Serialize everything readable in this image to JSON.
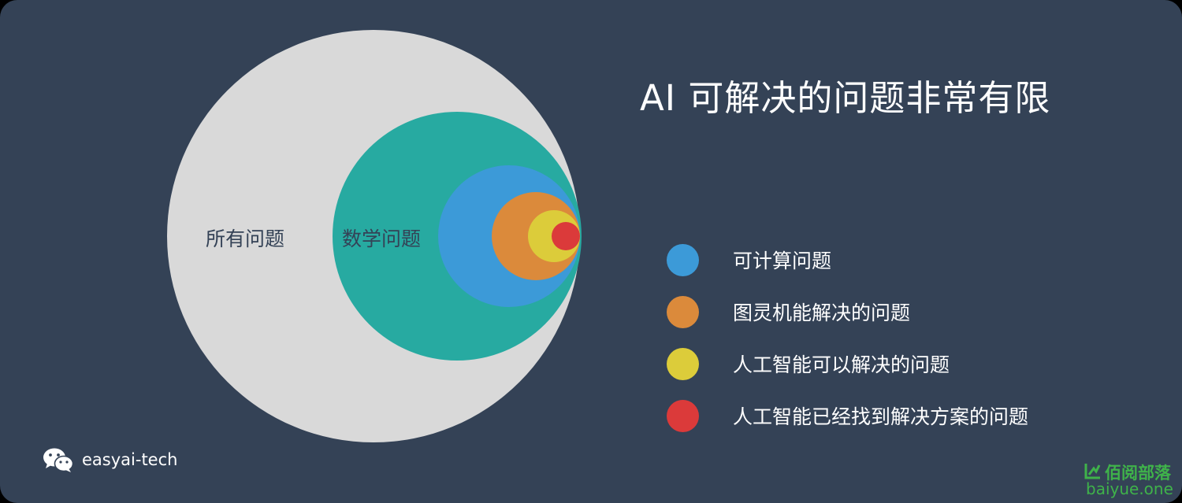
{
  "title": "AI 可解决的问题非常有限",
  "circles": [
    {
      "id": "all",
      "label": "所有问题",
      "color": "#d9d9d9"
    },
    {
      "id": "math",
      "label": "数学问题",
      "color": "#27aaa1"
    },
    {
      "id": "computable",
      "label": "",
      "color": "#3c9ad8"
    },
    {
      "id": "turing",
      "label": "",
      "color": "#db8a3b"
    },
    {
      "id": "ai",
      "label": "",
      "color": "#dccc3a"
    },
    {
      "id": "solved",
      "label": "",
      "color": "#db3a3a"
    }
  ],
  "legend": [
    {
      "label": "可计算问题",
      "color": "#3c9ad8"
    },
    {
      "label": "图灵机能解决的问题",
      "color": "#db8a3b"
    },
    {
      "label": "人工智能可以解决的问题",
      "color": "#dccc3a"
    },
    {
      "label": "人工智能已经找到解决方案的问题",
      "color": "#db3a3a"
    }
  ],
  "brand": {
    "icon": "wechat-icon",
    "handle": "easyai-tech"
  },
  "watermark": {
    "name": "佰阅部落",
    "domain": "baiyue.one",
    "color": "#3fb24a"
  }
}
